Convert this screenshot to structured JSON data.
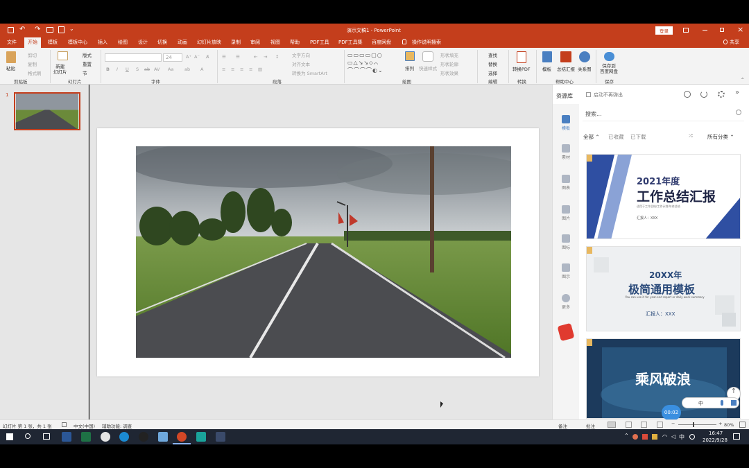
{
  "titlebar": {
    "title": "演示文稿1  -  PowerPoint",
    "login_label": "登录",
    "share_label": "共享"
  },
  "tabs": [
    "文件",
    "开始",
    "模板",
    "模板中心",
    "插入",
    "绘图",
    "设计",
    "切换",
    "动画",
    "幻灯片放映",
    "录制",
    "审阅",
    "视图",
    "帮助",
    "PDF工具",
    "PDF工具集",
    "百度网盘"
  ],
  "tell_me": "操作说明搜索",
  "ribbon": {
    "clipboard": {
      "paste": "粘贴",
      "cut": "剪切",
      "copy": "复制",
      "format_painter": "格式刷",
      "label": "剪贴板"
    },
    "slides": {
      "new_slide": "新建\n幻灯片",
      "layout": "版式",
      "reset": "重置",
      "section": "节",
      "label": "幻灯片"
    },
    "font": {
      "size": "24",
      "label": "字体"
    },
    "paragraph": {
      "text_direction": "文字方向",
      "align_text": "对齐文本",
      "smartart": "转换为 SmartArt",
      "label": "段落"
    },
    "drawing": {
      "arrange": "排列",
      "quick_styles": "快速样式",
      "shape_fill": "形状填充",
      "shape_outline": "形状轮廓",
      "shape_effects": "形状效果",
      "label": "绘图"
    },
    "editing": {
      "find": "查找",
      "replace": "替换",
      "select": "选择",
      "label": "编辑"
    },
    "convert": {
      "to_pdf": "转换PDF",
      "label": "转换"
    },
    "help_center": {
      "template": "模板",
      "summary": "总结汇报",
      "relation": "关系图",
      "label": "帮助中心"
    },
    "save": {
      "to_baidu": "保存到\n百度网盘",
      "label": "保存"
    }
  },
  "thumbnails": {
    "slide_number": "1"
  },
  "resource_panel": {
    "title": "资源库",
    "checkbox_label": "启动不再弹出",
    "search_placeholder": "搜索...",
    "filters": {
      "all": "全部",
      "favorited": "已收藏",
      "downloaded": "已下载",
      "category": "所有分类"
    },
    "side_items": [
      "模板",
      "素材",
      "图表",
      "图片",
      "图标",
      "图示",
      "更多"
    ],
    "cards": [
      {
        "title": "2021年度",
        "subtitle": "工作总结汇报",
        "tagline": "适用于工作总结/工作计划/年终总结",
        "reporter": "汇报人：XXX"
      },
      {
        "title": "20XX年",
        "subtitle": "极简通用模板",
        "tagline": "You can use it for year-end report or daily work summary",
        "reporter": "汇报人：XXX"
      },
      {
        "title": "乘风破浪"
      }
    ],
    "timer": "00:02",
    "ime_label": "中"
  },
  "statusbar": {
    "slide_info": "幻灯片 第 1 张，共 1 张",
    "language": "中文(中国)",
    "accessibility": "辅助功能: 调查",
    "notes": "备注",
    "comments": "批注",
    "zoom": "80%"
  },
  "taskbar": {
    "time": "16:47",
    "date": "2022/9/28",
    "ime": "中"
  },
  "colors": {
    "accent": "#c43e1c",
    "taskbar": "#1f2633"
  }
}
